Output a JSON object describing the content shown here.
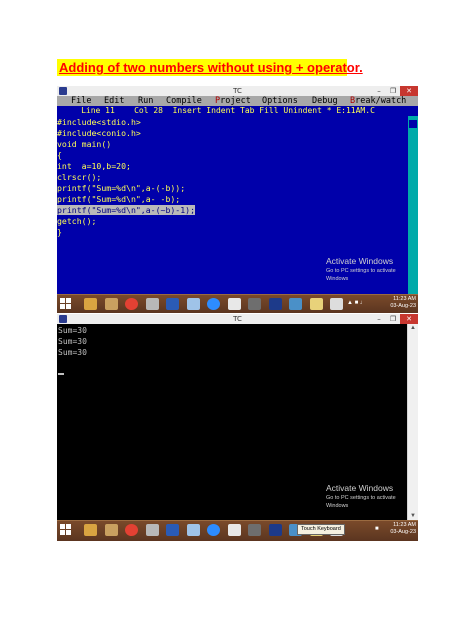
{
  "heading": "Adding of two numbers without using + operator.",
  "ide_window": {
    "title": "TC",
    "menu": [
      {
        "pre": "",
        "key": "",
        "rest": "File"
      },
      {
        "pre": "",
        "key": "",
        "rest": "Edit"
      },
      {
        "pre": "",
        "key": "",
        "rest": "Run"
      },
      {
        "pre": "",
        "key": "",
        "rest": "Compile"
      },
      {
        "pre": "",
        "key": "P",
        "rest": "roject"
      },
      {
        "pre": "",
        "key": "",
        "rest": "Options"
      },
      {
        "pre": "",
        "key": "",
        "rest": "Debug"
      },
      {
        "pre": "",
        "key": "B",
        "rest": "reak/watch"
      }
    ],
    "status_line": "     Line 11    Col 28  Insert Indent Tab Fill Unindent * E:11AM.C",
    "code_lines": [
      "#include<stdio.h>",
      "#include<conio.h>",
      "void main()",
      "{",
      "int  a=10,b=20;",
      "clrscr();",
      "printf(\"Sum=%d\\n\",a-(-b));",
      "printf(\"Sum=%d\\n\",a- -b);",
      "printf(\"Sum=%d\\n\",a-(~b)-1);",
      "getch();",
      "}"
    ],
    "highlighted_line": 8
  },
  "watermark": {
    "title": "Activate Windows",
    "line1": "Go to PC settings to activate",
    "line2": "Windows"
  },
  "taskbar_top": {
    "time": "11:23 AM",
    "date": "03-Aug-23"
  },
  "console_window": {
    "title": "TC",
    "output_lines": [
      "Sum=30",
      "Sum=30",
      "Sum=30"
    ]
  },
  "taskbar_bottom": {
    "touch_keyboard": "Touch Keyboard",
    "time": "11:23 AM",
    "date": "03-Aug-23"
  },
  "taskbar_icons": [
    {
      "name": "folder-icon",
      "color": "#d9a441"
    },
    {
      "name": "file-explorer-icon",
      "color": "#c9a060"
    },
    {
      "name": "chrome-icon",
      "color": "#e34133"
    },
    {
      "name": "tools-icon",
      "color": "#b8b8b8"
    },
    {
      "name": "word-icon",
      "color": "#2a5bb6"
    },
    {
      "name": "notepad-icon",
      "color": "#9fc3e8"
    },
    {
      "name": "zoom-icon",
      "color": "#2d8cff"
    },
    {
      "name": "document-icon",
      "color": "#e8e8e8"
    },
    {
      "name": "calculator-icon",
      "color": "#6e6e6e"
    },
    {
      "name": "turbo-c-icon",
      "color": "#1d3a8a"
    },
    {
      "name": "control-panel-icon",
      "color": "#4a90c8"
    },
    {
      "name": "paint-icon",
      "color": "#e8d27a"
    },
    {
      "name": "keyboard-icon",
      "color": "#dddddd"
    }
  ]
}
